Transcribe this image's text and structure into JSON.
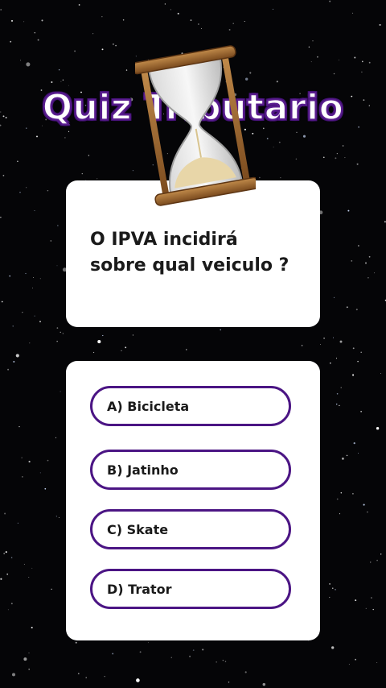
{
  "title": "Quiz Tributario",
  "question": {
    "line1": "O IPVA incidirá",
    "line2": "sobre qual veiculo ?"
  },
  "options": [
    {
      "label": "A) Bicicleta"
    },
    {
      "label": "B) Jatinho"
    },
    {
      "label": "C) Skate"
    },
    {
      "label": "D) Trator"
    }
  ],
  "colors": {
    "background": "#050507",
    "accent": "#4b1584",
    "card": "#ffffff",
    "text": "#1a1a1a"
  },
  "icons": {
    "hourglass": "hourglass-icon"
  }
}
